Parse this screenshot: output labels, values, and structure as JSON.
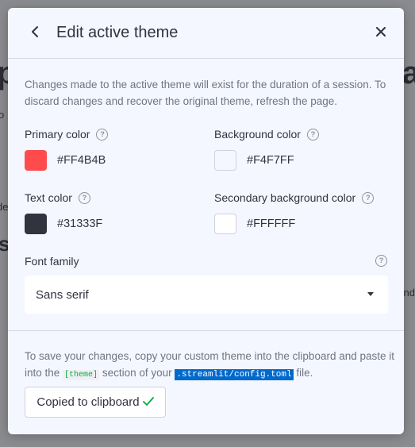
{
  "modal": {
    "title": "Edit active theme",
    "description": "Changes made to the active theme will exist for the duration of a session. To discard changes and recover the original theme, refresh the page."
  },
  "colors": {
    "primary": {
      "label": "Primary color",
      "value": "#FF4B4B"
    },
    "background": {
      "label": "Background color",
      "value": "#F4F7FF"
    },
    "text": {
      "label": "Text color",
      "value": "#31333F"
    },
    "secondary_background": {
      "label": "Secondary background color",
      "value": "#FFFFFF"
    }
  },
  "font_family": {
    "label": "Font family",
    "selected": "Sans serif"
  },
  "save": {
    "text_before": "To save your changes, copy your custom theme into the clipboard and paste it into the ",
    "theme_code": "[theme]",
    "text_middle": " section of your ",
    "file_code": ".streamlit/config.toml",
    "text_after": " file.",
    "button_label": "Copied to clipboard"
  },
  "background_page": {
    "frag_p": "p",
    "frag_na": "na",
    "frag_s": "s",
    "frag_o": "o",
    "frag_de": "de",
    "frag_nd": "nd"
  },
  "icons": [
    "back-arrow-icon",
    "close-icon",
    "help-icon",
    "dropdown-arrow-icon",
    "check-icon"
  ]
}
